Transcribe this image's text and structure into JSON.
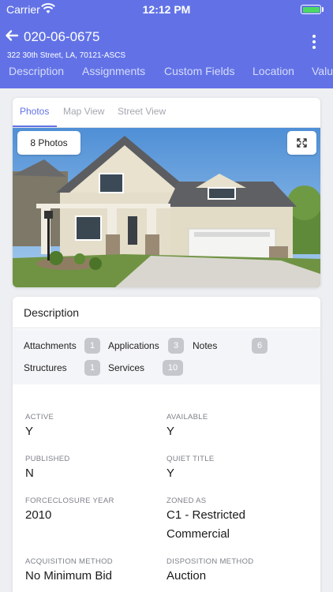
{
  "status_bar": {
    "carrier": "Carrier",
    "time": "12:12 PM"
  },
  "header": {
    "title": "020-06-0675",
    "subtitle": "322 30th Street, LA, 70121-ASCS",
    "tabs": [
      "Description",
      "Assignments",
      "Custom Fields",
      "Location",
      "Valu"
    ]
  },
  "photo_card": {
    "tabs": [
      "Photos",
      "Map View",
      "Street View"
    ],
    "active_tab": "Photos",
    "photos_button": "8 Photos"
  },
  "description": {
    "title": "Description",
    "counts": [
      {
        "label": "Attachments",
        "count": "1"
      },
      {
        "label": "Applications",
        "count": "3"
      },
      {
        "label": "Notes",
        "count": "6"
      },
      {
        "label": "Structures",
        "count": "1"
      },
      {
        "label": "Services",
        "count": "10"
      }
    ],
    "fields": [
      {
        "label": "ACTIVE",
        "value": "Y"
      },
      {
        "label": "AVAILABLE",
        "value": "Y"
      },
      {
        "label": "PUBLISHED",
        "value": "N"
      },
      {
        "label": "QUIET TITLE",
        "value": "Y"
      },
      {
        "label": "FORCECLOSURE YEAR",
        "value": "2010"
      },
      {
        "label": "ZONED AS",
        "value": "C1 - Restricted Commercial"
      },
      {
        "label": "ACQUISITION METHOD",
        "value": "No Minimum Bid"
      },
      {
        "label": "DISPOSITION METHOD",
        "value": "Auction"
      }
    ]
  },
  "colors": {
    "accent": "#6272e6",
    "badge": "#c5c7cd",
    "battery": "#4cd964"
  }
}
